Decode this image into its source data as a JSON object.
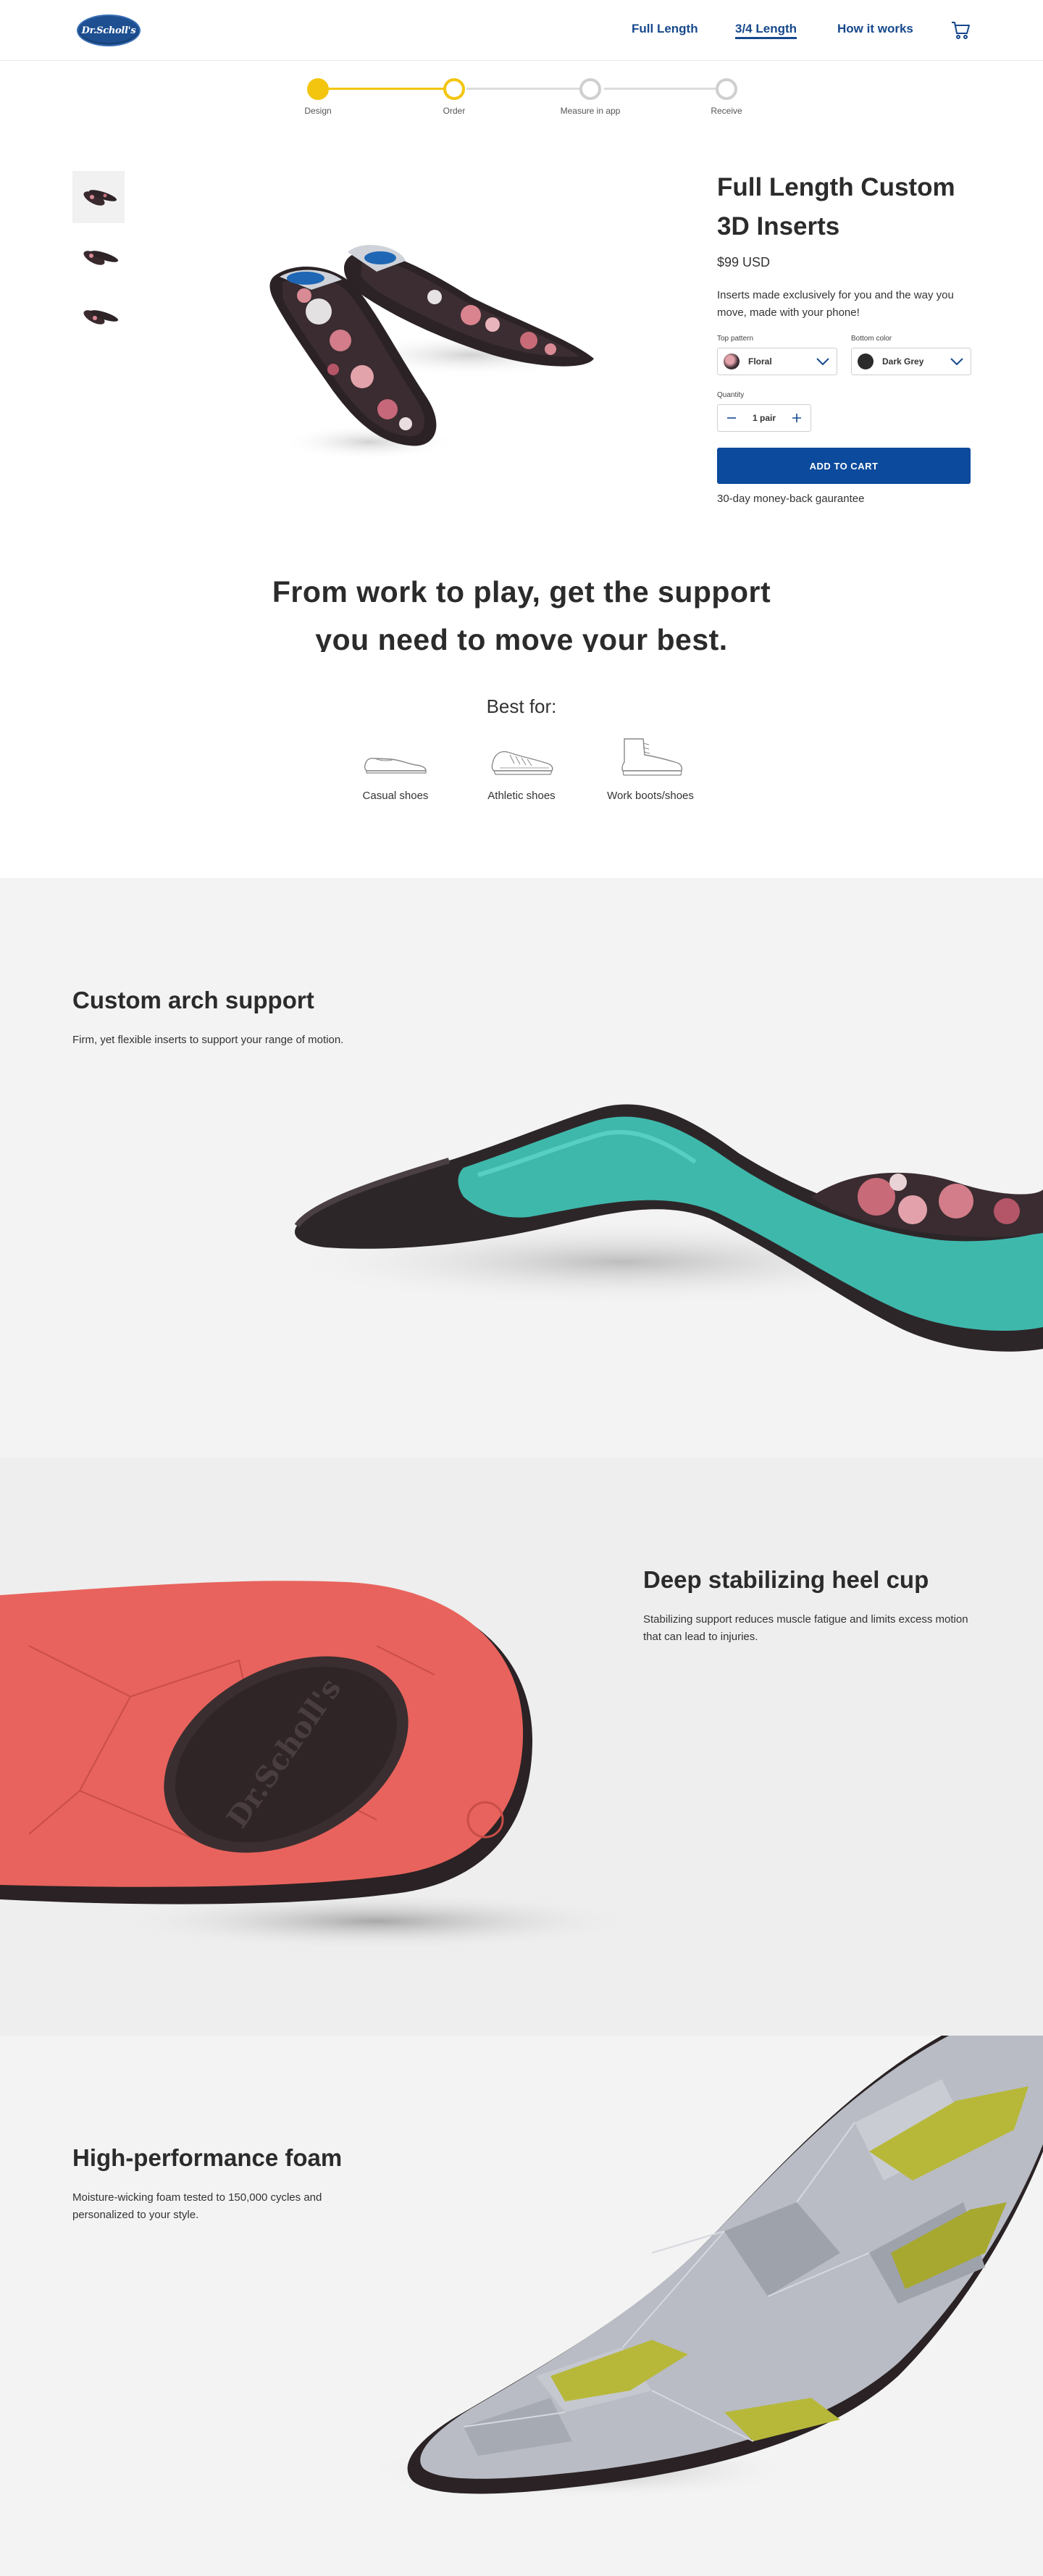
{
  "header": {
    "logo_text": "Dr.Scholl's",
    "nav": [
      {
        "label": "Full Length",
        "active": false
      },
      {
        "label": "3/4 Length",
        "active": true
      },
      {
        "label": "How it works",
        "active": false
      }
    ],
    "cart_icon": "cart-icon",
    "brand_color": "#16488c"
  },
  "progress": {
    "steps": [
      {
        "label": "Design",
        "state": "complete"
      },
      {
        "label": "Order",
        "state": "current"
      },
      {
        "label": "Measure in app",
        "state": "pending"
      },
      {
        "label": "Receive",
        "state": "pending"
      }
    ],
    "accent_color": "#f3c50f"
  },
  "product": {
    "title": "Full Length Custom 3D Inserts",
    "price": "$99 USD",
    "description": "Inserts made exclusively for you and the way you move, made with your phone!",
    "top_pattern": {
      "label": "Top pattern",
      "value": "Floral"
    },
    "bottom_color": {
      "label": "Bottom color",
      "value": "Dark Grey",
      "swatch": "#2b2b2b"
    },
    "quantity": {
      "label": "Quantity",
      "value": "1 pair"
    },
    "add_to_cart": "ADD TO CART",
    "guarantee": "30-day money-back gaurantee"
  },
  "headline": {
    "line1": "From work to play, get the support",
    "line2": "you need to move your best."
  },
  "best_for": {
    "title": "Best for:",
    "items": [
      {
        "label": "Casual shoes",
        "icon": "casual-shoe-icon"
      },
      {
        "label": "Athletic shoes",
        "icon": "athletic-shoe-icon"
      },
      {
        "label": "Work boots/shoes",
        "icon": "work-boot-icon"
      }
    ]
  },
  "features": [
    {
      "title": "Custom arch support",
      "text": "Firm, yet flexible inserts to support your range of motion."
    },
    {
      "title": "Deep stabilizing heel cup",
      "text": "Stabilizing support reduces muscle fatigue and limits excess motion that can lead to injuries."
    },
    {
      "title": "High-performance foam",
      "text": "Moisture-wicking foam tested to 150,000 cycles and personalized to your style."
    }
  ],
  "heel_logo_text": "Dr.Scholl's"
}
